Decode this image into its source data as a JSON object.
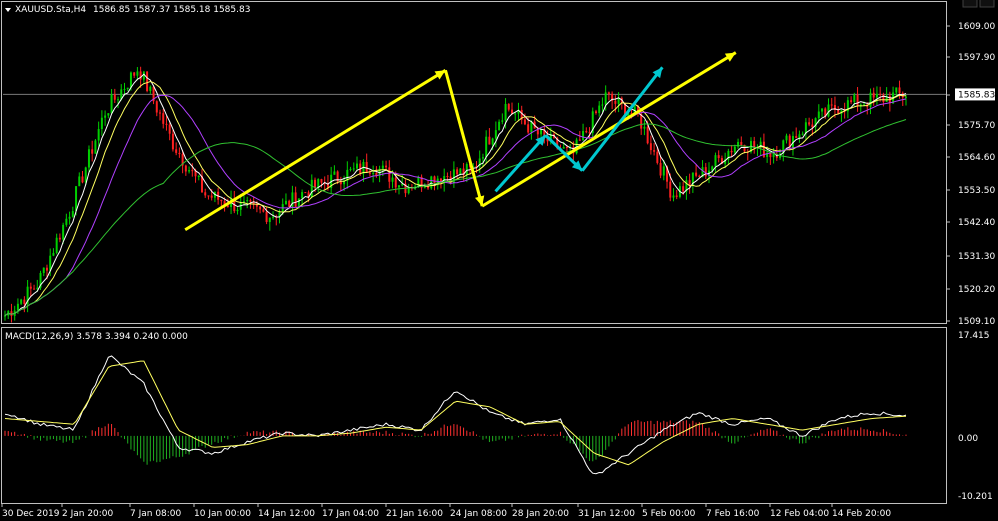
{
  "header": {
    "symbol": "XAUUSD.Sta,H4",
    "ohlc": "1586.85 1587.37 1585.18 1585.83",
    "indicator": "MACD(12,26,9) 3.578 3.394 0.240 0.000"
  },
  "chart_data": [
    {
      "type": "candlestick",
      "title": "XAUUSD.Sta,H4",
      "ylim": [
        1505,
        1620
      ],
      "y_ticks": [
        "1609.00",
        "1597.90",
        "1586.80",
        "1575.70",
        "1564.60",
        "1553.50",
        "1542.40",
        "1531.30",
        "1520.20",
        "1509.10"
      ],
      "current_price": "1585.83",
      "x_labels": [
        "30 Dec 2019",
        "2 Jan 20:00",
        "7 Jan 08:00",
        "10 Jan 00:00",
        "14 Jan 12:00",
        "17 Jan 04:00",
        "21 Jan 16:00",
        "24 Jan 08:00",
        "28 Jan 20:00",
        "31 Jan 12:00",
        "5 Feb 00:00",
        "7 Feb 16:00",
        "12 Feb 04:00",
        "14 Feb 20:00"
      ],
      "close_anchors": [
        1511,
        1522,
        1548,
        1580,
        1595,
        1570,
        1552,
        1548,
        1545,
        1553,
        1558,
        1562,
        1555,
        1558,
        1560,
        1582,
        1572,
        1565,
        1585,
        1578,
        1552,
        1560,
        1570,
        1566,
        1575,
        1582,
        1584,
        1586
      ],
      "moving_averages": [
        "white",
        "yellow",
        "violet",
        "limegreen"
      ],
      "annotations": [
        {
          "color": "#ffff00",
          "points": [
            [
              5.4,
              1540
            ],
            [
              13.2,
              1594
            ]
          ]
        },
        {
          "color": "#ffff00",
          "points": [
            [
              13.2,
              1594
            ],
            [
              14.3,
              1548
            ]
          ]
        },
        {
          "color": "#ffff00",
          "points": [
            [
              14.3,
              1548
            ],
            [
              21.9,
              1600
            ]
          ]
        },
        {
          "color": "#00c8d0",
          "points": [
            [
              14.7,
              1553
            ],
            [
              16.2,
              1572
            ]
          ]
        },
        {
          "color": "#00c8d0",
          "points": [
            [
              16.2,
              1572
            ],
            [
              17.3,
              1560
            ]
          ]
        },
        {
          "color": "#00c8d0",
          "points": [
            [
              17.3,
              1560
            ],
            [
              19.7,
              1595
            ]
          ]
        }
      ]
    },
    {
      "type": "macd",
      "title": "MACD(12,26,9) 3.578 3.394 0.240 0.000",
      "ylim": [
        -10.201,
        17.415
      ],
      "y_ticks": [
        "17.415",
        "0.00",
        "-10.201"
      ],
      "macd_anchors": [
        4,
        2,
        1,
        14,
        9,
        -2,
        -3,
        -1,
        0.5,
        0,
        1,
        2,
        1,
        8,
        4,
        2,
        3,
        -7,
        -3,
        1,
        4,
        2,
        3,
        0,
        3,
        4,
        3.5
      ],
      "signal_anchors": [
        3,
        2.5,
        2,
        12,
        13,
        1,
        -2,
        -1.5,
        0,
        0,
        0.5,
        1.5,
        1,
        6,
        5,
        2,
        2.5,
        -3,
        -5,
        -1,
        2,
        3,
        2,
        1,
        2,
        3,
        3.4
      ]
    }
  ]
}
